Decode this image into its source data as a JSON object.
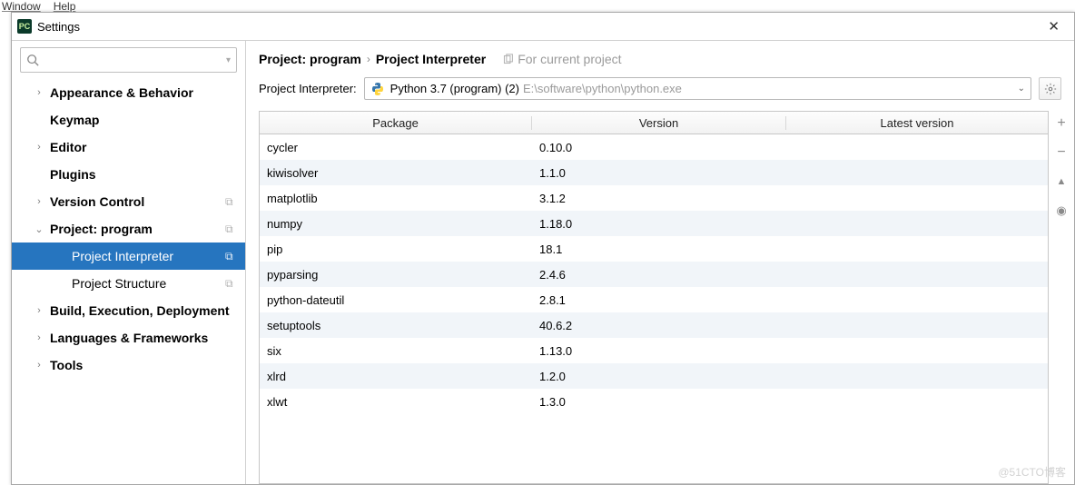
{
  "menubar": {
    "item1": "Window",
    "item2": "Help"
  },
  "window": {
    "title": "Settings",
    "close": "✕",
    "app_icon": "PC"
  },
  "search": {
    "placeholder": ""
  },
  "sidebar": {
    "items": [
      {
        "label": "Appearance & Behavior",
        "depth": 1,
        "chev": "›",
        "bold": true
      },
      {
        "label": "Keymap",
        "depth": 1,
        "chev": "",
        "bold": true
      },
      {
        "label": "Editor",
        "depth": 1,
        "chev": "›",
        "bold": true
      },
      {
        "label": "Plugins",
        "depth": 1,
        "chev": "",
        "bold": true
      },
      {
        "label": "Version Control",
        "depth": 1,
        "chev": "›",
        "bold": true,
        "icon": true
      },
      {
        "label": "Project: program",
        "depth": 1,
        "chev": "⌄",
        "bold": true,
        "icon": true
      },
      {
        "label": "Project Interpreter",
        "depth": 2,
        "chev": "",
        "bold": false,
        "icon": true,
        "selected": true
      },
      {
        "label": "Project Structure",
        "depth": 2,
        "chev": "",
        "bold": false,
        "icon": true
      },
      {
        "label": "Build, Execution, Deployment",
        "depth": 1,
        "chev": "›",
        "bold": true
      },
      {
        "label": "Languages & Frameworks",
        "depth": 1,
        "chev": "›",
        "bold": true
      },
      {
        "label": "Tools",
        "depth": 1,
        "chev": "›",
        "bold": true
      }
    ]
  },
  "breadcrumb": {
    "root": "Project: program",
    "sep": "›",
    "leaf": "Project Interpreter",
    "for_label": "For current project"
  },
  "interpreter": {
    "label": "Project Interpreter:",
    "name": "Python 3.7 (program) (2)",
    "path": "E:\\software\\python\\python.exe"
  },
  "table": {
    "headers": {
      "pkg": "Package",
      "ver": "Version",
      "lat": "Latest version"
    },
    "rows": [
      {
        "pkg": "cycler",
        "ver": "0.10.0",
        "lat": ""
      },
      {
        "pkg": "kiwisolver",
        "ver": "1.1.0",
        "lat": ""
      },
      {
        "pkg": "matplotlib",
        "ver": "3.1.2",
        "lat": ""
      },
      {
        "pkg": "numpy",
        "ver": "1.18.0",
        "lat": ""
      },
      {
        "pkg": "pip",
        "ver": "18.1",
        "lat": ""
      },
      {
        "pkg": "pyparsing",
        "ver": "2.4.6",
        "lat": ""
      },
      {
        "pkg": "python-dateutil",
        "ver": "2.8.1",
        "lat": ""
      },
      {
        "pkg": "setuptools",
        "ver": "40.6.2",
        "lat": ""
      },
      {
        "pkg": "six",
        "ver": "1.13.0",
        "lat": ""
      },
      {
        "pkg": "xlrd",
        "ver": "1.2.0",
        "lat": ""
      },
      {
        "pkg": "xlwt",
        "ver": "1.3.0",
        "lat": ""
      }
    ]
  },
  "sidebuttons": {
    "add": "+",
    "remove": "−",
    "upgrade": "▲",
    "show": "◉"
  },
  "watermark": "@51CTO博客"
}
